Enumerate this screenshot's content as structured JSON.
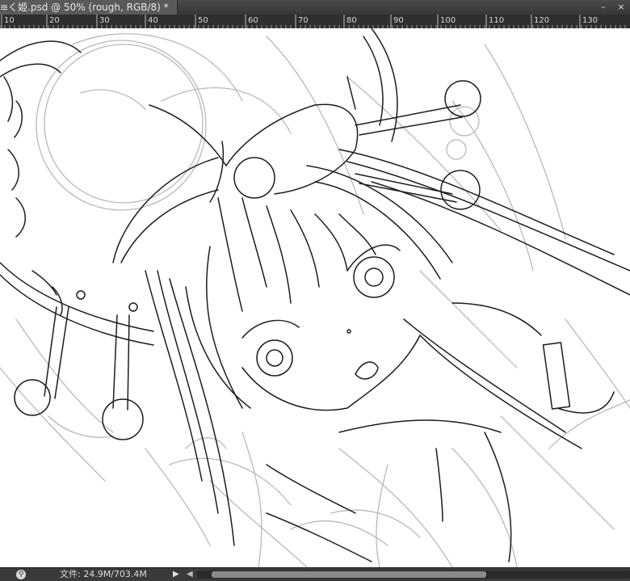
{
  "document": {
    "tab_title": "≡く姫.psd @ 50% (rough, RGB/8) *"
  },
  "window": {
    "minimize_icon": "minimize-icon",
    "close_icon": "close-icon",
    "minimize_label": "–",
    "close_label": "×"
  },
  "ruler": {
    "labels": [
      "10",
      "20",
      "30",
      "40",
      "50",
      "60",
      "70",
      "80",
      "90",
      "100",
      "110",
      "120",
      "130"
    ],
    "ticks": [
      2,
      58,
      120,
      180,
      242,
      304,
      366,
      426,
      484,
      542,
      602,
      658,
      718
    ]
  },
  "canvas": {
    "description_icon": "line-art-sketch"
  },
  "status": {
    "zoom_icon": "zoom-icon",
    "zoom_glyph": "⚲",
    "doc_size": "文件: 24.9M/703.4M",
    "menu_arrow": "▶",
    "scroll_left": "◀"
  }
}
